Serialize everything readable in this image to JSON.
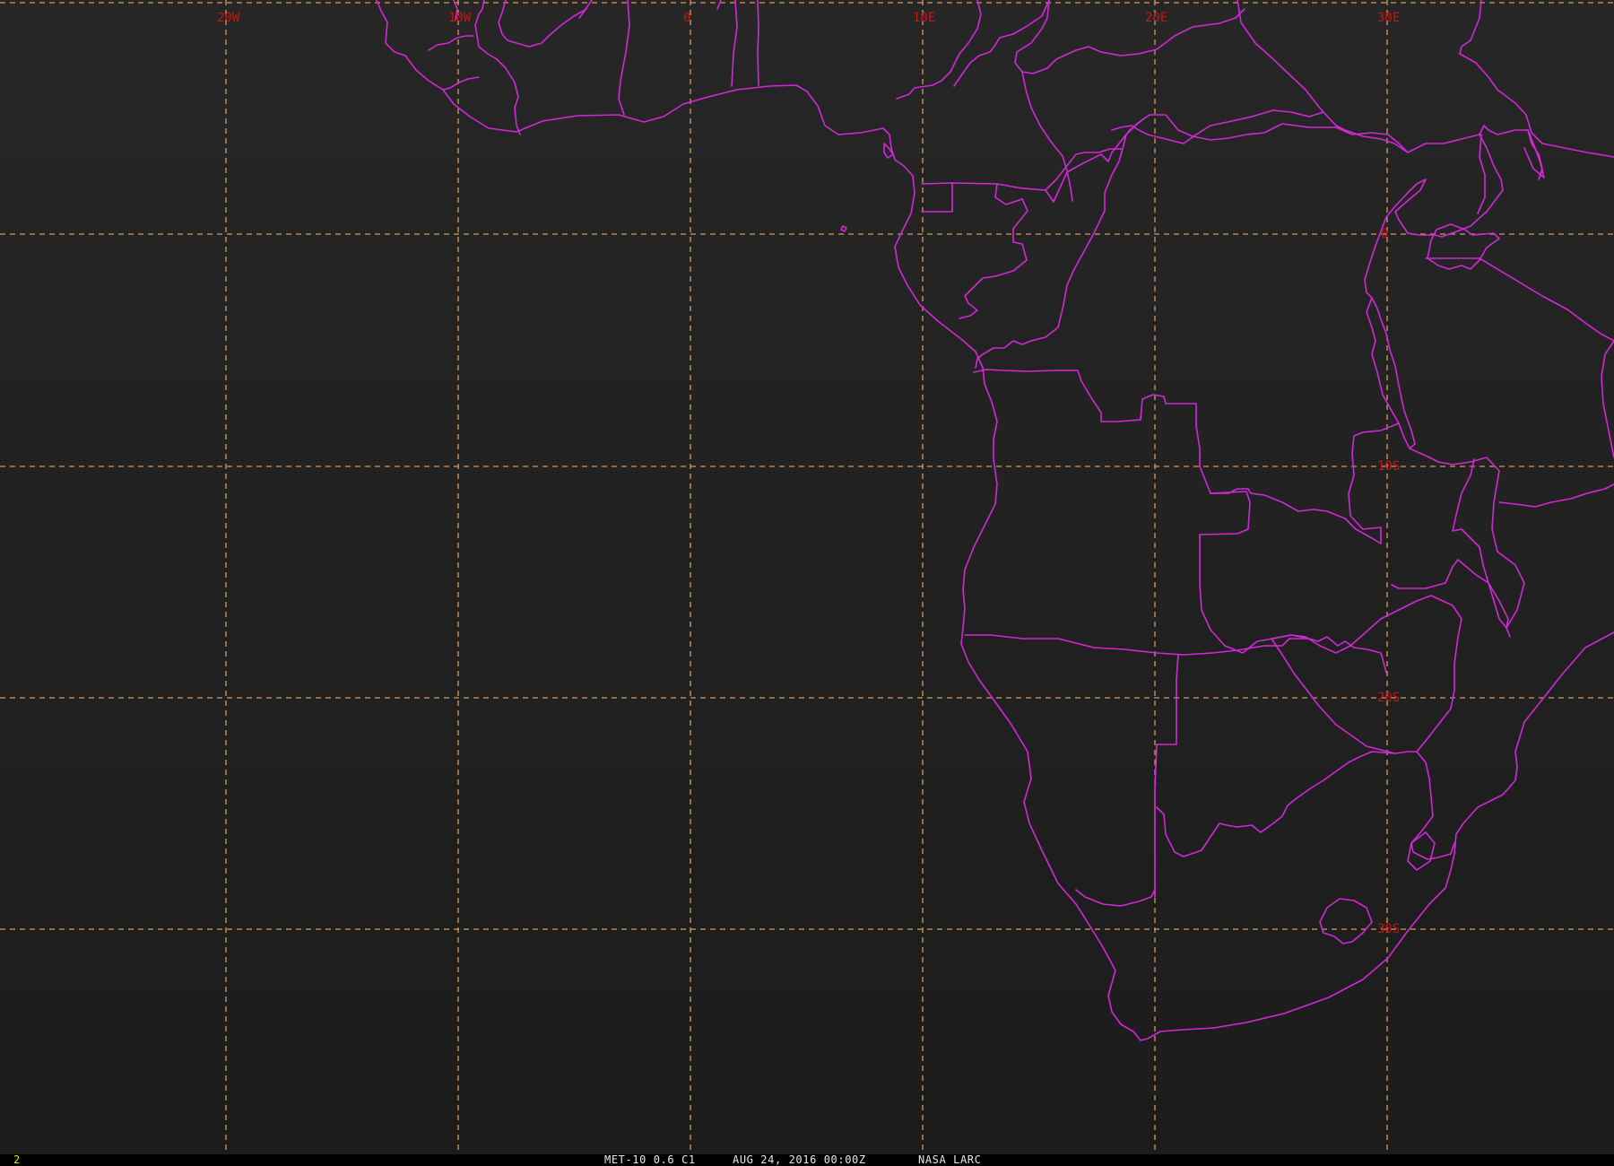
{
  "map": {
    "graticule_labels": {
      "lon_20w": "20W",
      "lon_10w": "10W",
      "lon_0": "0",
      "lon_10e": "10E",
      "lon_20e": "20E",
      "lon_30e": "30E",
      "lat_0": "0",
      "lat_10s": "10S",
      "lat_20s": "20S",
      "lat_30s": "30S"
    },
    "colors": {
      "background": "#1e1e1e",
      "boundaries": "#d228d6",
      "graticule": "#d99a5a",
      "graticule_labels": "#c01818"
    }
  },
  "status": {
    "frame_number": "2",
    "product": "MET-10 0.6 C1",
    "datetime": "AUG 24, 2016 00:00Z",
    "source": "NASA LARC"
  }
}
